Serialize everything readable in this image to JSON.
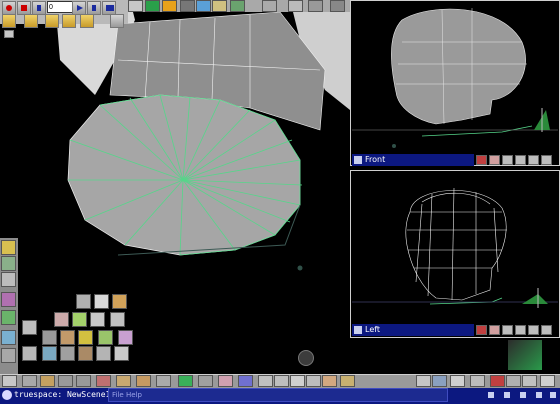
{
  "toolbar": {
    "frame_field_value": "0",
    "icons": [
      "record-icon",
      "rewind-icon",
      "play-icon",
      "step-back-icon",
      "step-forward-icon",
      "fast-forward-icon",
      "keyframe-icon",
      "render-icon",
      "camera-icon"
    ]
  },
  "viewports": {
    "front": {
      "title": "Front"
    },
    "left": {
      "title": "Left"
    }
  },
  "menu": {
    "file": "File",
    "help": "Help"
  },
  "taskbar": {
    "title": "truespace: NewScene10"
  },
  "colors": {
    "background": "#000000",
    "titlebar": "#0c1880",
    "toolbar": "#b9b9b9",
    "mesh_face": "#a6a6a6",
    "selection": "#56d68a"
  }
}
